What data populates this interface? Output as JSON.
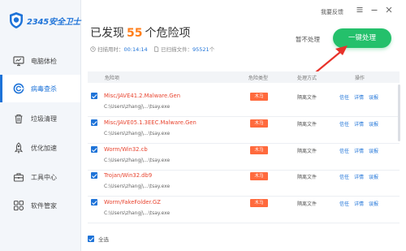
{
  "app": {
    "logo_text": "2345安全卫士",
    "feedback": "我要反馈"
  },
  "colors": {
    "accent": "#1e73d8",
    "danger": "#e8442f",
    "tag": "#ff6a3d",
    "fix_button": "#24c06b",
    "count": "#ff7e1a"
  },
  "sidebar": {
    "items": [
      {
        "label": "电脑体检",
        "icon": "monitor-icon",
        "active": false
      },
      {
        "label": "病毒查杀",
        "icon": "virus-scan-icon",
        "active": true
      },
      {
        "label": "垃圾清理",
        "icon": "trash-icon",
        "active": false
      },
      {
        "label": "优化加速",
        "icon": "rocket-icon",
        "active": false
      },
      {
        "label": "工具中心",
        "icon": "toolbox-icon",
        "active": false
      },
      {
        "label": "软件管家",
        "icon": "software-manager-icon",
        "active": false
      }
    ]
  },
  "header": {
    "title_prefix": "已发现",
    "count": "55",
    "title_suffix": "个危险项",
    "scan_time_label": "扫描用时：",
    "scan_time_value": "00:14:14",
    "scanned_label": "已扫描文件：",
    "scanned_value": "95521",
    "unit": "个",
    "ignore_label": "暂不处理",
    "fix_label": "一键处理"
  },
  "table": {
    "columns": [
      "危险项",
      "危险类型",
      "处理方式",
      "操作"
    ],
    "rows": [
      {
        "name": "Misc/JAVE41.2.Malware.Gen",
        "path": "C:\\Users\\zhangj\\...\\tsay.exe",
        "type": "木马",
        "method": "隔离文件",
        "actions": [
          "信任",
          "详情",
          "误报"
        ]
      },
      {
        "name": "Misc/JAVE05.1.3EEC.Malware.Gen",
        "path": "C:\\Users\\zhangj\\...\\tsay.exe",
        "type": "木马",
        "method": "隔离文件",
        "actions": [
          "信任",
          "详情",
          "误报"
        ]
      },
      {
        "name": "Worm/Win32.cb",
        "path": "C:\\Users\\zhangj\\...\\tsay.exe",
        "type": "木马",
        "method": "隔离文件",
        "actions": [
          "信任",
          "详情",
          "误报"
        ]
      },
      {
        "name": "Trojan/Win32.db9",
        "path": "C:\\Users\\zhangj\\...\\tsay.exe",
        "type": "木马",
        "method": "隔离文件",
        "actions": [
          "信任",
          "详情",
          "误报"
        ]
      },
      {
        "name": "Worm/FakeFolder.GZ",
        "path": "C:\\Users\\zhangj\\...\\tsay.exe",
        "type": "木马",
        "method": "隔离文件",
        "actions": [
          "信任",
          "详情",
          "误报"
        ]
      }
    ]
  },
  "footer": {
    "select_all": "全选"
  }
}
